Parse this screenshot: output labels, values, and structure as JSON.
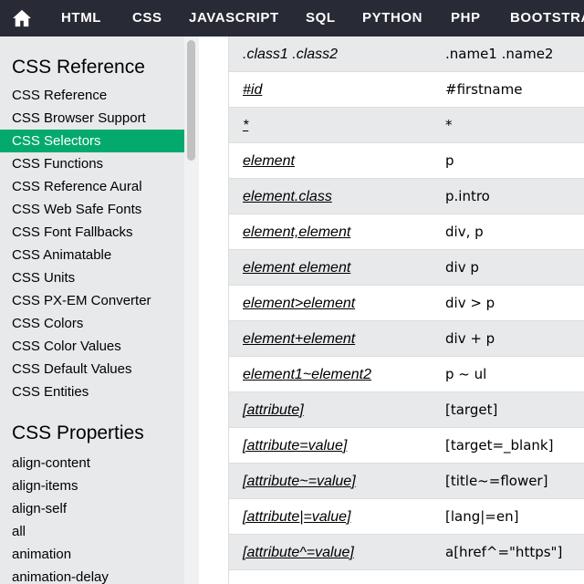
{
  "nav": {
    "home_icon": "home-icon",
    "items": [
      "HTML",
      "CSS",
      "JAVASCRIPT",
      "SQL",
      "PYTHON",
      "PHP",
      "BOOTSTRAP"
    ]
  },
  "sidebar": {
    "reference_heading": "CSS Reference",
    "reference_links": [
      "CSS Reference",
      "CSS Browser Support",
      "CSS Selectors",
      "CSS Functions",
      "CSS Reference Aural",
      "CSS Web Safe Fonts",
      "CSS Font Fallbacks",
      "CSS Animatable",
      "CSS Units",
      "CSS PX-EM Converter",
      "CSS Colors",
      "CSS Color Values",
      "CSS Default Values",
      "CSS Entities"
    ],
    "active_link": "CSS Selectors",
    "properties_heading": "CSS Properties",
    "property_links": [
      "align-content",
      "align-items",
      "align-self",
      "all",
      "animation",
      "animation-delay"
    ]
  },
  "table": {
    "rows": [
      {
        "selector": ".class1 .class2",
        "example": ".name1 .name2",
        "linked": false
      },
      {
        "selector": "#id",
        "example": "#firstname",
        "linked": true
      },
      {
        "selector": "*",
        "example": "*",
        "linked": true
      },
      {
        "selector": "element",
        "example": "p",
        "linked": true
      },
      {
        "selector": "element.class",
        "example": "p.intro",
        "linked": true
      },
      {
        "selector": "element,element",
        "example": "div, p",
        "linked": true
      },
      {
        "selector": "element element",
        "example": "div p",
        "linked": true
      },
      {
        "selector": "element>element",
        "example": "div > p",
        "linked": true
      },
      {
        "selector": "element+element",
        "example": "div + p",
        "linked": true
      },
      {
        "selector": "element1~element2",
        "example": "p ~ ul",
        "linked": true
      },
      {
        "selector": "[attribute]",
        "example": "[target]",
        "linked": true
      },
      {
        "selector": "[attribute=value]",
        "example": "[target=_blank]",
        "linked": true
      },
      {
        "selector": "[attribute~=value]",
        "example": "[title~=flower]",
        "linked": true
      },
      {
        "selector": "[attribute|=value]",
        "example": "[lang|=en]",
        "linked": true
      },
      {
        "selector": "[attribute^=value]",
        "example": "a[href^=\"https\"]",
        "linked": true
      },
      {
        "selector": "",
        "example": "",
        "linked": false
      }
    ]
  },
  "colors": {
    "nav_bg": "#282a35",
    "sidebar_bg": "#e7e9eb",
    "active_bg": "#04aa6d",
    "row_alt_bg": "#e7e9eb"
  }
}
